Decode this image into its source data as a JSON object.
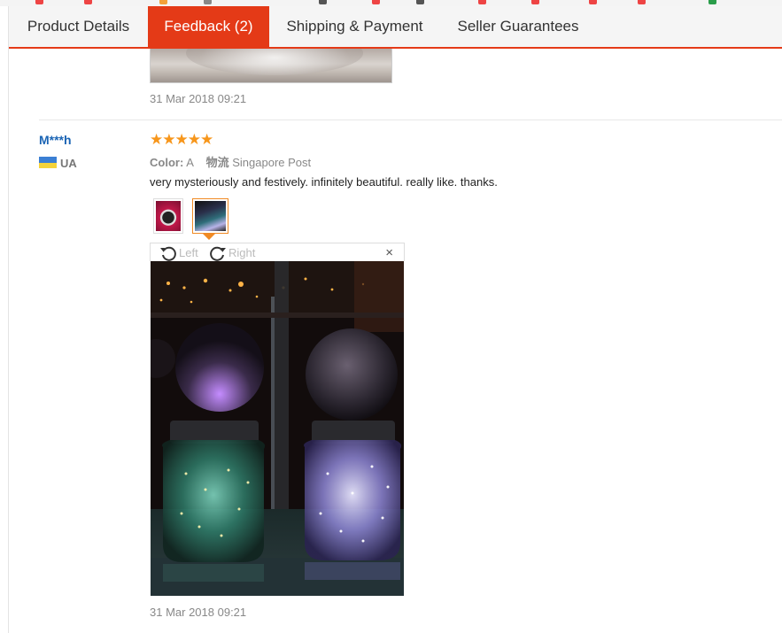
{
  "tabs": [
    {
      "label": "Product Details",
      "active": false
    },
    {
      "label": "Feedback (2)",
      "active": true
    },
    {
      "label": "Shipping & Payment",
      "active": false
    },
    {
      "label": "Seller Guarantees",
      "active": false
    }
  ],
  "previous_review": {
    "date": "31 Mar 2018 09:21"
  },
  "review": {
    "user": "M***h",
    "country": "UA",
    "stars": "★★★★★",
    "rating": 5,
    "color_label": "Color:",
    "color_value": "A",
    "logistics_label": "物流",
    "logistics_value": "Singapore Post",
    "comment": "very mysteriously and festively. infinitely beautiful. really like. thanks.",
    "date": "31 Mar 2018 09:21"
  },
  "viewer": {
    "rotate_left": "Left",
    "rotate_right": "Right",
    "close": "×"
  },
  "colors": {
    "accent": "#e43a17",
    "username": "#1a64b4",
    "star": "#f7961b",
    "thumb_selected": "#f08a24"
  }
}
